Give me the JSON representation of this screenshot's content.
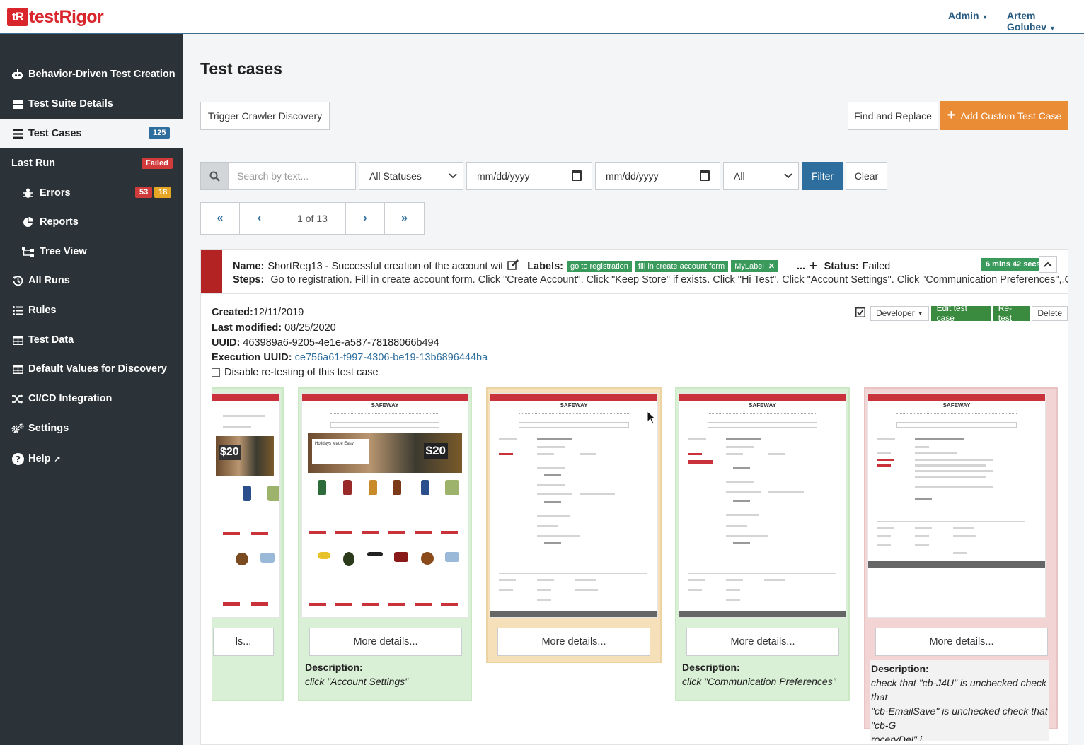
{
  "brand": {
    "mark": "tR",
    "name": "testRigor",
    "color": "#d8262c"
  },
  "topbar": {
    "admin": "Admin",
    "user": "Artem Golubev"
  },
  "sidebar": {
    "items": [
      {
        "label": "Behavior-Driven Test Creation",
        "icon": "robot-icon"
      },
      {
        "label": "Test Suite Details",
        "icon": "grid-icon"
      },
      {
        "label": "Test Cases",
        "icon": "list-icon",
        "badge": "125"
      },
      {
        "label": "Last Run",
        "badge": "Failed"
      },
      {
        "label": "Errors",
        "icon": "bug-icon",
        "badge1": "53",
        "badge2": "18"
      },
      {
        "label": "Reports",
        "icon": "pie-chart-icon"
      },
      {
        "label": "Tree View",
        "icon": "tree-icon"
      },
      {
        "label": "All Runs",
        "icon": "history-icon"
      },
      {
        "label": "Rules",
        "icon": "list-bullets-icon"
      },
      {
        "label": "Test Data",
        "icon": "table-icon"
      },
      {
        "label": "Default Values for Discovery",
        "icon": "table-icon"
      },
      {
        "label": "CI/CD Integration",
        "icon": "shuffle-icon"
      },
      {
        "label": "Settings",
        "icon": "gears-icon"
      },
      {
        "label": "Help",
        "icon": "question-icon"
      }
    ]
  },
  "page": {
    "title": "Test cases",
    "trigger_label": "Trigger Crawler Discovery",
    "find_replace_label": "Find and Replace",
    "add_custom_label": "Add Custom Test Case"
  },
  "filters": {
    "search_placeholder": "Search by text...",
    "status_value": "All Statuses",
    "date_from": "mm/dd/yyyy",
    "date_to": "mm/dd/yyyy",
    "type_value": "All",
    "filter_label": "Filter",
    "clear_label": "Clear"
  },
  "pager": {
    "first": "«",
    "prev": "‹",
    "label": "1 of 13",
    "next": "›",
    "last": "»"
  },
  "testcase": {
    "name_label": "Name:",
    "name": "ShortReg13 - Successful creation of the account wit",
    "labels_label": "Labels:",
    "tags": [
      "go to registration",
      "fill in create account form",
      "MyLabel"
    ],
    "ellipsis": "...",
    "status_label": "Status:",
    "status": "Failed",
    "duration": "6 mins 42 secs",
    "steps_label": "Steps:",
    "steps": "Go to registration. Fill in create account form. Click \"Create Account\". Click \"Keep Store\" if exists. Click \"Hi Test\". Click \"Account Settings\". Click \"Communication Preferences\",,C",
    "created_label": "Created:",
    "created": "12/11/2019",
    "modified_label": "Last modified:",
    "modified": "08/25/2020",
    "uuid_label": "UUID:",
    "uuid": "463989a6-9205-4e1e-a587-78188066b494",
    "exec_label": "Execution UUID:",
    "exec_uuid": "ce756a61-f997-4306-be19-13b6896444ba",
    "disable_label": "Disable re-testing of this test case",
    "developer_label": "Developer",
    "edit_label": "Edit test case",
    "retest_label": "Re-test",
    "delete_label": "Delete"
  },
  "screenshots": [
    {
      "more": "ls...",
      "status": "passed"
    },
    {
      "more": "More details...",
      "status": "passed",
      "desc_label": "Description:",
      "desc": "click \"Account Settings\""
    },
    {
      "more": "More details...",
      "status": "warning"
    },
    {
      "more": "More details...",
      "status": "passed",
      "desc_label": "Description:",
      "desc": "click \"Communication Preferences\""
    },
    {
      "more": "More details...",
      "status": "failed",
      "desc_label": "Description:",
      "desc1": "check that \"cb-J4U\" is unchecked check that",
      "desc2": "\"cb-EmailSave\" is unchecked check that \"cb-G",
      "desc3": "roceryDel\" i",
      "desc_more": "..."
    }
  ],
  "shot_brand": "SAFEWAY",
  "shot_banner": "Holidays Made Easy",
  "shot_price": "$20"
}
